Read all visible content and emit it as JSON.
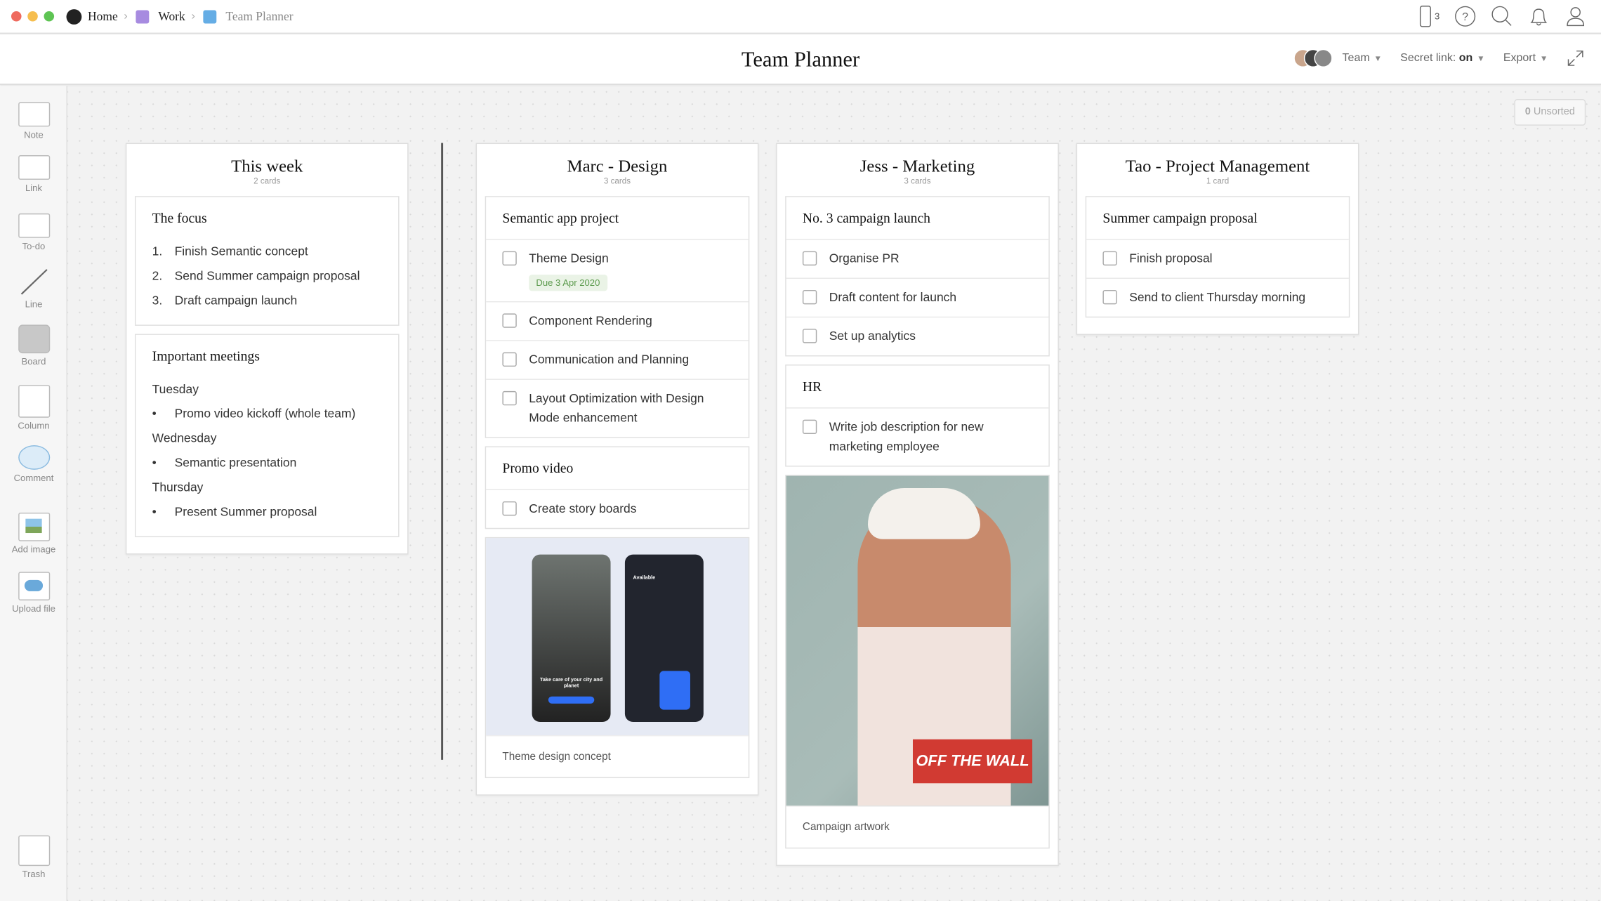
{
  "topbar": {
    "breadcrumbs": [
      {
        "label": "Home",
        "color": "#222222"
      },
      {
        "label": "Work",
        "color": "#a78be0"
      },
      {
        "label": "Team Planner",
        "color": "#65ade5"
      }
    ],
    "device_count": "3",
    "icons": [
      "mobile-icon",
      "help-icon",
      "search-icon",
      "bell-icon",
      "user-icon"
    ]
  },
  "header": {
    "title": "Team Planner",
    "team": "Team",
    "secret_link_label": "Secret link:",
    "secret_link_value": "on",
    "export": "Export"
  },
  "sidebar": {
    "tools": [
      "Note",
      "Link",
      "To-do",
      "Line",
      "Board",
      "Column",
      "Comment",
      "Add image",
      "Upload file"
    ],
    "trash": "Trash"
  },
  "unsorted": {
    "count": "0",
    "label": "Unsorted"
  },
  "columns": [
    {
      "title": "This week",
      "count": "2 cards",
      "cards": [
        {
          "type": "note",
          "title": "The focus",
          "items": [
            {
              "m": "1.",
              "t": "Finish Semantic concept"
            },
            {
              "m": "2.",
              "t": "Send Summer campaign proposal"
            },
            {
              "m": "3.",
              "t": "Draft campaign launch"
            }
          ]
        },
        {
          "type": "note",
          "title": "Important meetings",
          "items": [
            {
              "t": "Tuesday"
            },
            {
              "m": "•",
              "t": "Promo video kickoff (whole team)"
            },
            {
              "t": "Wednesday"
            },
            {
              "m": "•",
              "t": "Semantic presentation"
            },
            {
              "t": "Thursday"
            },
            {
              "m": "•",
              "t": "Present Summer proposal"
            }
          ]
        }
      ]
    },
    {
      "title": "Marc - Design",
      "count": "3 cards",
      "cards": [
        {
          "type": "todo",
          "title": "Semantic app project",
          "tasks": [
            {
              "t": "Theme Design",
              "due": "Due 3 Apr 2020"
            },
            {
              "t": "Component Rendering"
            },
            {
              "t": "Communication and Planning"
            },
            {
              "t": "Layout Optimization with Design Mode enhancement"
            }
          ]
        },
        {
          "type": "todo",
          "title": "Promo video",
          "tasks": [
            {
              "t": "Create story boards"
            }
          ]
        },
        {
          "type": "image",
          "image": "phones",
          "caption": "Theme design concept",
          "phone_texts": [
            "Take care of your city and planet",
            "Available"
          ]
        }
      ]
    },
    {
      "title": "Jess - Marketing",
      "count": "3 cards",
      "cards": [
        {
          "type": "todo",
          "title": "No. 3 campaign launch",
          "tasks": [
            {
              "t": "Organise PR"
            },
            {
              "t": "Draft content for launch"
            },
            {
              "t": "Set up analytics"
            }
          ]
        },
        {
          "type": "todo",
          "title": "HR",
          "tasks": [
            {
              "t": "Write job description for new marketing employee"
            }
          ]
        },
        {
          "type": "image",
          "image": "artwork",
          "caption": "Campaign artwork",
          "logo_text": "OFF THE WALL"
        }
      ]
    },
    {
      "title": "Tao - Project Management",
      "count": "1 card",
      "cards": [
        {
          "type": "todo",
          "title": "Summer campaign proposal",
          "tasks": [
            {
              "t": "Finish proposal"
            },
            {
              "t": "Send to client Thursday morning"
            }
          ]
        }
      ]
    }
  ]
}
